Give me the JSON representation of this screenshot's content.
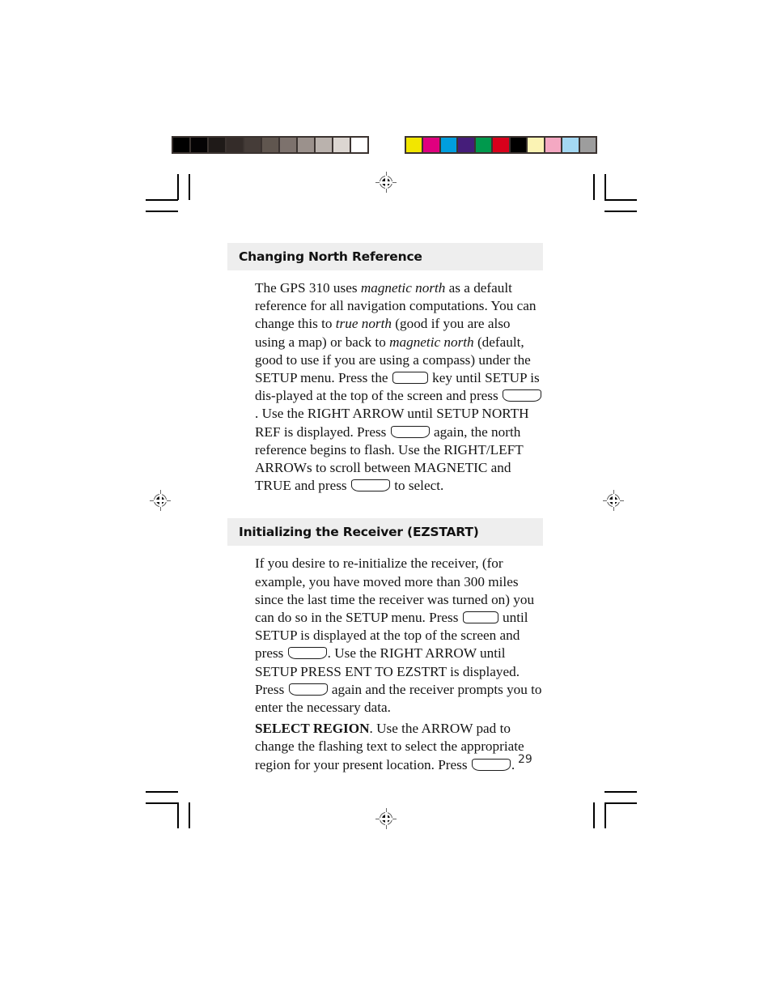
{
  "page": {
    "number": "29"
  },
  "calibration": {
    "gray_strip_name": "grayscale-calibration-strip",
    "gray_swatches": [
      "#000000",
      "#050304",
      "#1f1a18",
      "#342c29",
      "#453c38",
      "#60564f",
      "#7d726d",
      "#9b918c",
      "#bab2ad",
      "#dcd6d1",
      "#ffffff"
    ],
    "color_strip_name": "color-calibration-strip",
    "color_swatches": [
      "#f2e600",
      "#e0007f",
      "#009ede",
      "#451d7a",
      "#00994d",
      "#d9001b",
      "#000000",
      "#fbf3b4",
      "#f4a8c2",
      "#a4d8f2",
      "#9d9d9d"
    ]
  },
  "sections": [
    {
      "heading": "Changing North Reference",
      "paragraphs": [
        {
          "runs": [
            {
              "type": "text",
              "text": "The GPS 310 uses "
            },
            {
              "type": "italic",
              "text": "magnetic north"
            },
            {
              "type": "text",
              "text": " as a default reference for all navigation computations.  You can change this to "
            },
            {
              "type": "italic",
              "text": "true north"
            },
            {
              "type": "text",
              "text": " (good if you are also using a map) or back to "
            },
            {
              "type": "italic",
              "text": "magnetic north"
            },
            {
              "type": "text",
              "text": " (default, good to use if you are using a compass) under the SETUP menu.  Press the "
            },
            {
              "type": "key",
              "text": ""
            },
            {
              "type": "text",
              "text": " key until SETUP is dis-played at the top of the screen and press "
            },
            {
              "type": "key-curved",
              "text": ""
            },
            {
              "type": "text",
              "text": ".  Use the RIGHT ARROW until SETUP NORTH REF is displayed.  Press "
            },
            {
              "type": "key-curved",
              "text": ""
            },
            {
              "type": "text",
              "text": " again, the north reference begins to flash.  Use the RIGHT/LEFT ARROWs to scroll between MAGNETIC and TRUE and press "
            },
            {
              "type": "key-curved",
              "text": ""
            },
            {
              "type": "text",
              "text": " to select."
            }
          ]
        }
      ]
    },
    {
      "heading": "Initializing the Receiver (EZSTART)",
      "paragraphs": [
        {
          "runs": [
            {
              "type": "text",
              "text": "If you desire to re-initialize the receiver, (for example, you have moved more than 300 miles since the last time the receiver was turned on) you can do so in the SETUP menu.  Press "
            },
            {
              "type": "key",
              "text": ""
            },
            {
              "type": "text",
              "text": " until SETUP is displayed at the top of the screen and press "
            },
            {
              "type": "key-curved",
              "text": ""
            },
            {
              "type": "text",
              "text": ".  Use the RIGHT ARROW until SETUP PRESS ENT TO EZSTRT is displayed.  Press "
            },
            {
              "type": "key-curved",
              "text": ""
            },
            {
              "type": "text",
              "text": " again and the receiver prompts you to enter the necessary data."
            }
          ]
        },
        {
          "runs": [
            {
              "type": "bold",
              "text": "SELECT REGION"
            },
            {
              "type": "text",
              "text": ".  Use the  ARROW pad to change the flashing text to select the appropriate region for your present location.  Press "
            },
            {
              "type": "key-curved",
              "text": ""
            },
            {
              "type": "text",
              "text": "."
            }
          ]
        }
      ]
    }
  ]
}
